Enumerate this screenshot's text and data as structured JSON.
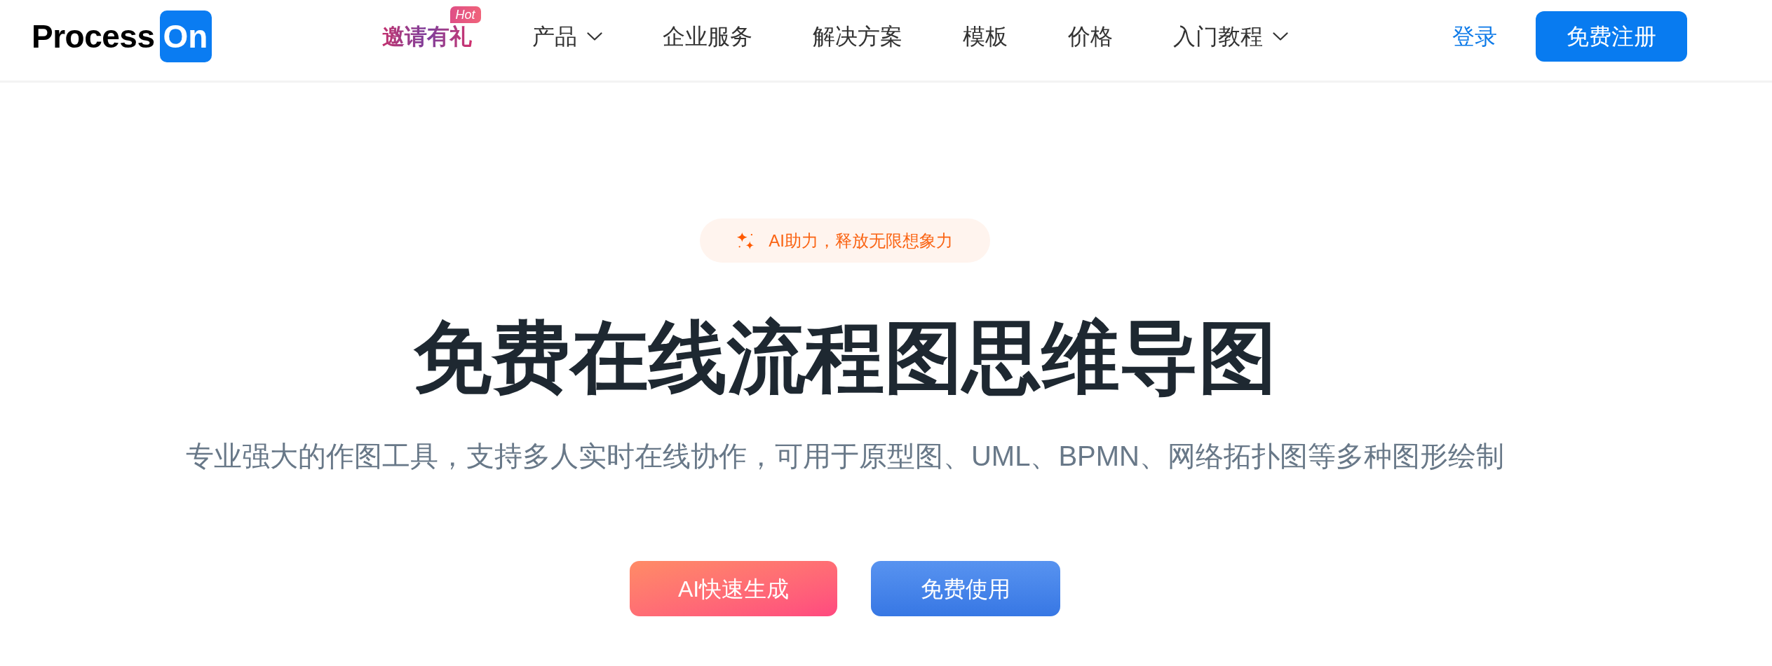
{
  "header": {
    "logo": {
      "text": "Process",
      "tile": "On"
    },
    "nav": [
      {
        "label": "邀请有礼",
        "kind": "promo",
        "badge": "Hot"
      },
      {
        "label": "产品",
        "kind": "dropdown"
      },
      {
        "label": "企业服务",
        "kind": "link"
      },
      {
        "label": "解决方案",
        "kind": "link"
      },
      {
        "label": "模板",
        "kind": "link"
      },
      {
        "label": "价格",
        "kind": "link"
      },
      {
        "label": "入门教程",
        "kind": "dropdown"
      }
    ],
    "login": "登录",
    "register": "免费注册"
  },
  "hero": {
    "tagline": "AI助力，释放无限想象力",
    "title": "免费在线流程图思维导图",
    "subtitle": "专业强大的作图工具，支持多人实时在线协作，可用于原型图、UML、BPMN、网络拓扑图等多种图形绘制",
    "buttons": [
      {
        "label": "AI快速生成",
        "kind": "ai"
      },
      {
        "label": "免费使用",
        "kind": "primary"
      }
    ]
  }
}
